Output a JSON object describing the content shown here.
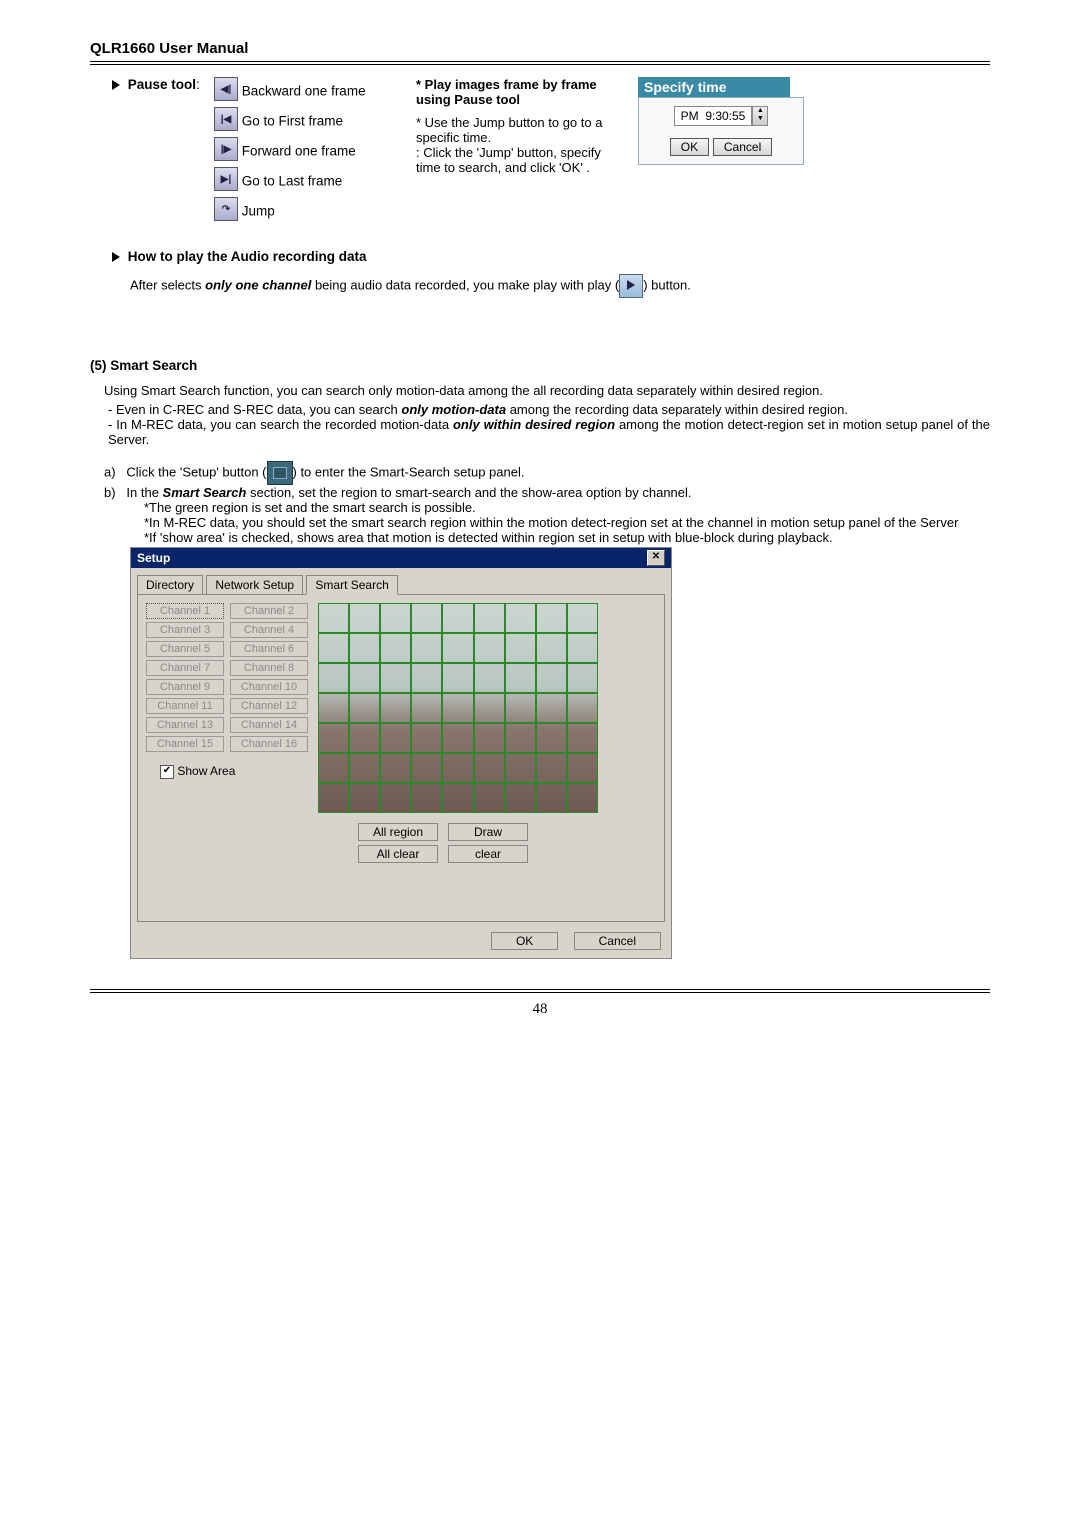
{
  "header": "QLR1660 User Manual",
  "pause_tool": "Pause tool",
  "icons": {
    "back": "Backward one frame",
    "first": "Go to First frame",
    "fwd": "Forward one frame",
    "last": "Go to Last frame",
    "jump": "Jump"
  },
  "frame_title": "Play images frame by frame using Pause tool",
  "frame_use": "* Use the Jump button to go to a specific time.",
  "frame_click": ": Click the 'Jump' button, specify time to search, and click 'OK' .",
  "specify": {
    "title": "Specify time",
    "ampm": "PM",
    "time": "9:30:55",
    "ok": "OK",
    "cancel": "Cancel"
  },
  "audio_h": "How to play the Audio recording data",
  "audio_p1": "After selects ",
  "audio_em": "only one channel",
  "audio_p2": " being audio data recorded, you make play with play (",
  "audio_p3": ") button.",
  "ss_h": "(5) Smart Search",
  "ss_p": "Using Smart Search function, you can search only motion-data among the all recording data separately within desired region.",
  "ss_b1a": "Even in C-REC and S-REC data, you can search ",
  "ss_b1b": "only motion-data",
  "ss_b1c": " among the recording data separately within desired region.",
  "ss_b2a": "In M-REC data, you can search the recorded motion-data ",
  "ss_b2b": "only within desired region",
  "ss_b2c": " among the motion detect-region set in motion setup panel of the Server.",
  "step_a1": "Click the 'Setup' button (",
  "step_a2": ") to enter the Smart-Search setup panel.",
  "step_b1": "In the ",
  "step_b1e": "Smart Search",
  "step_b1b": " section, set the region to smart-search and the show-area option by channel.",
  "note1": "*The green region is set and the smart search is possible.",
  "note2": "*In M-REC data, you should set the smart search region within the motion detect-region set at the channel in motion setup panel of the Server",
  "note3": "*If 'show area' is checked, shows area that motion is detected within region set in setup with blue-block during playback.",
  "setup": {
    "title": "Setup",
    "tabs": {
      "dir": "Directory",
      "net": "Network Setup",
      "ss": "Smart Search"
    },
    "channels": [
      "Channel 1",
      "Channel 2",
      "Channel 3",
      "Channel 4",
      "Channel 5",
      "Channel 6",
      "Channel 7",
      "Channel 8",
      "Channel 9",
      "Channel 10",
      "Channel 11",
      "Channel 12",
      "Channel 13",
      "Channel 14",
      "Channel 15",
      "Channel 16"
    ],
    "showarea": "Show Area",
    "allregion": "All region",
    "draw": "Draw",
    "allclear": "All clear",
    "clear": "clear",
    "ok": "OK",
    "cancel": "Cancel"
  },
  "pageno": "48"
}
